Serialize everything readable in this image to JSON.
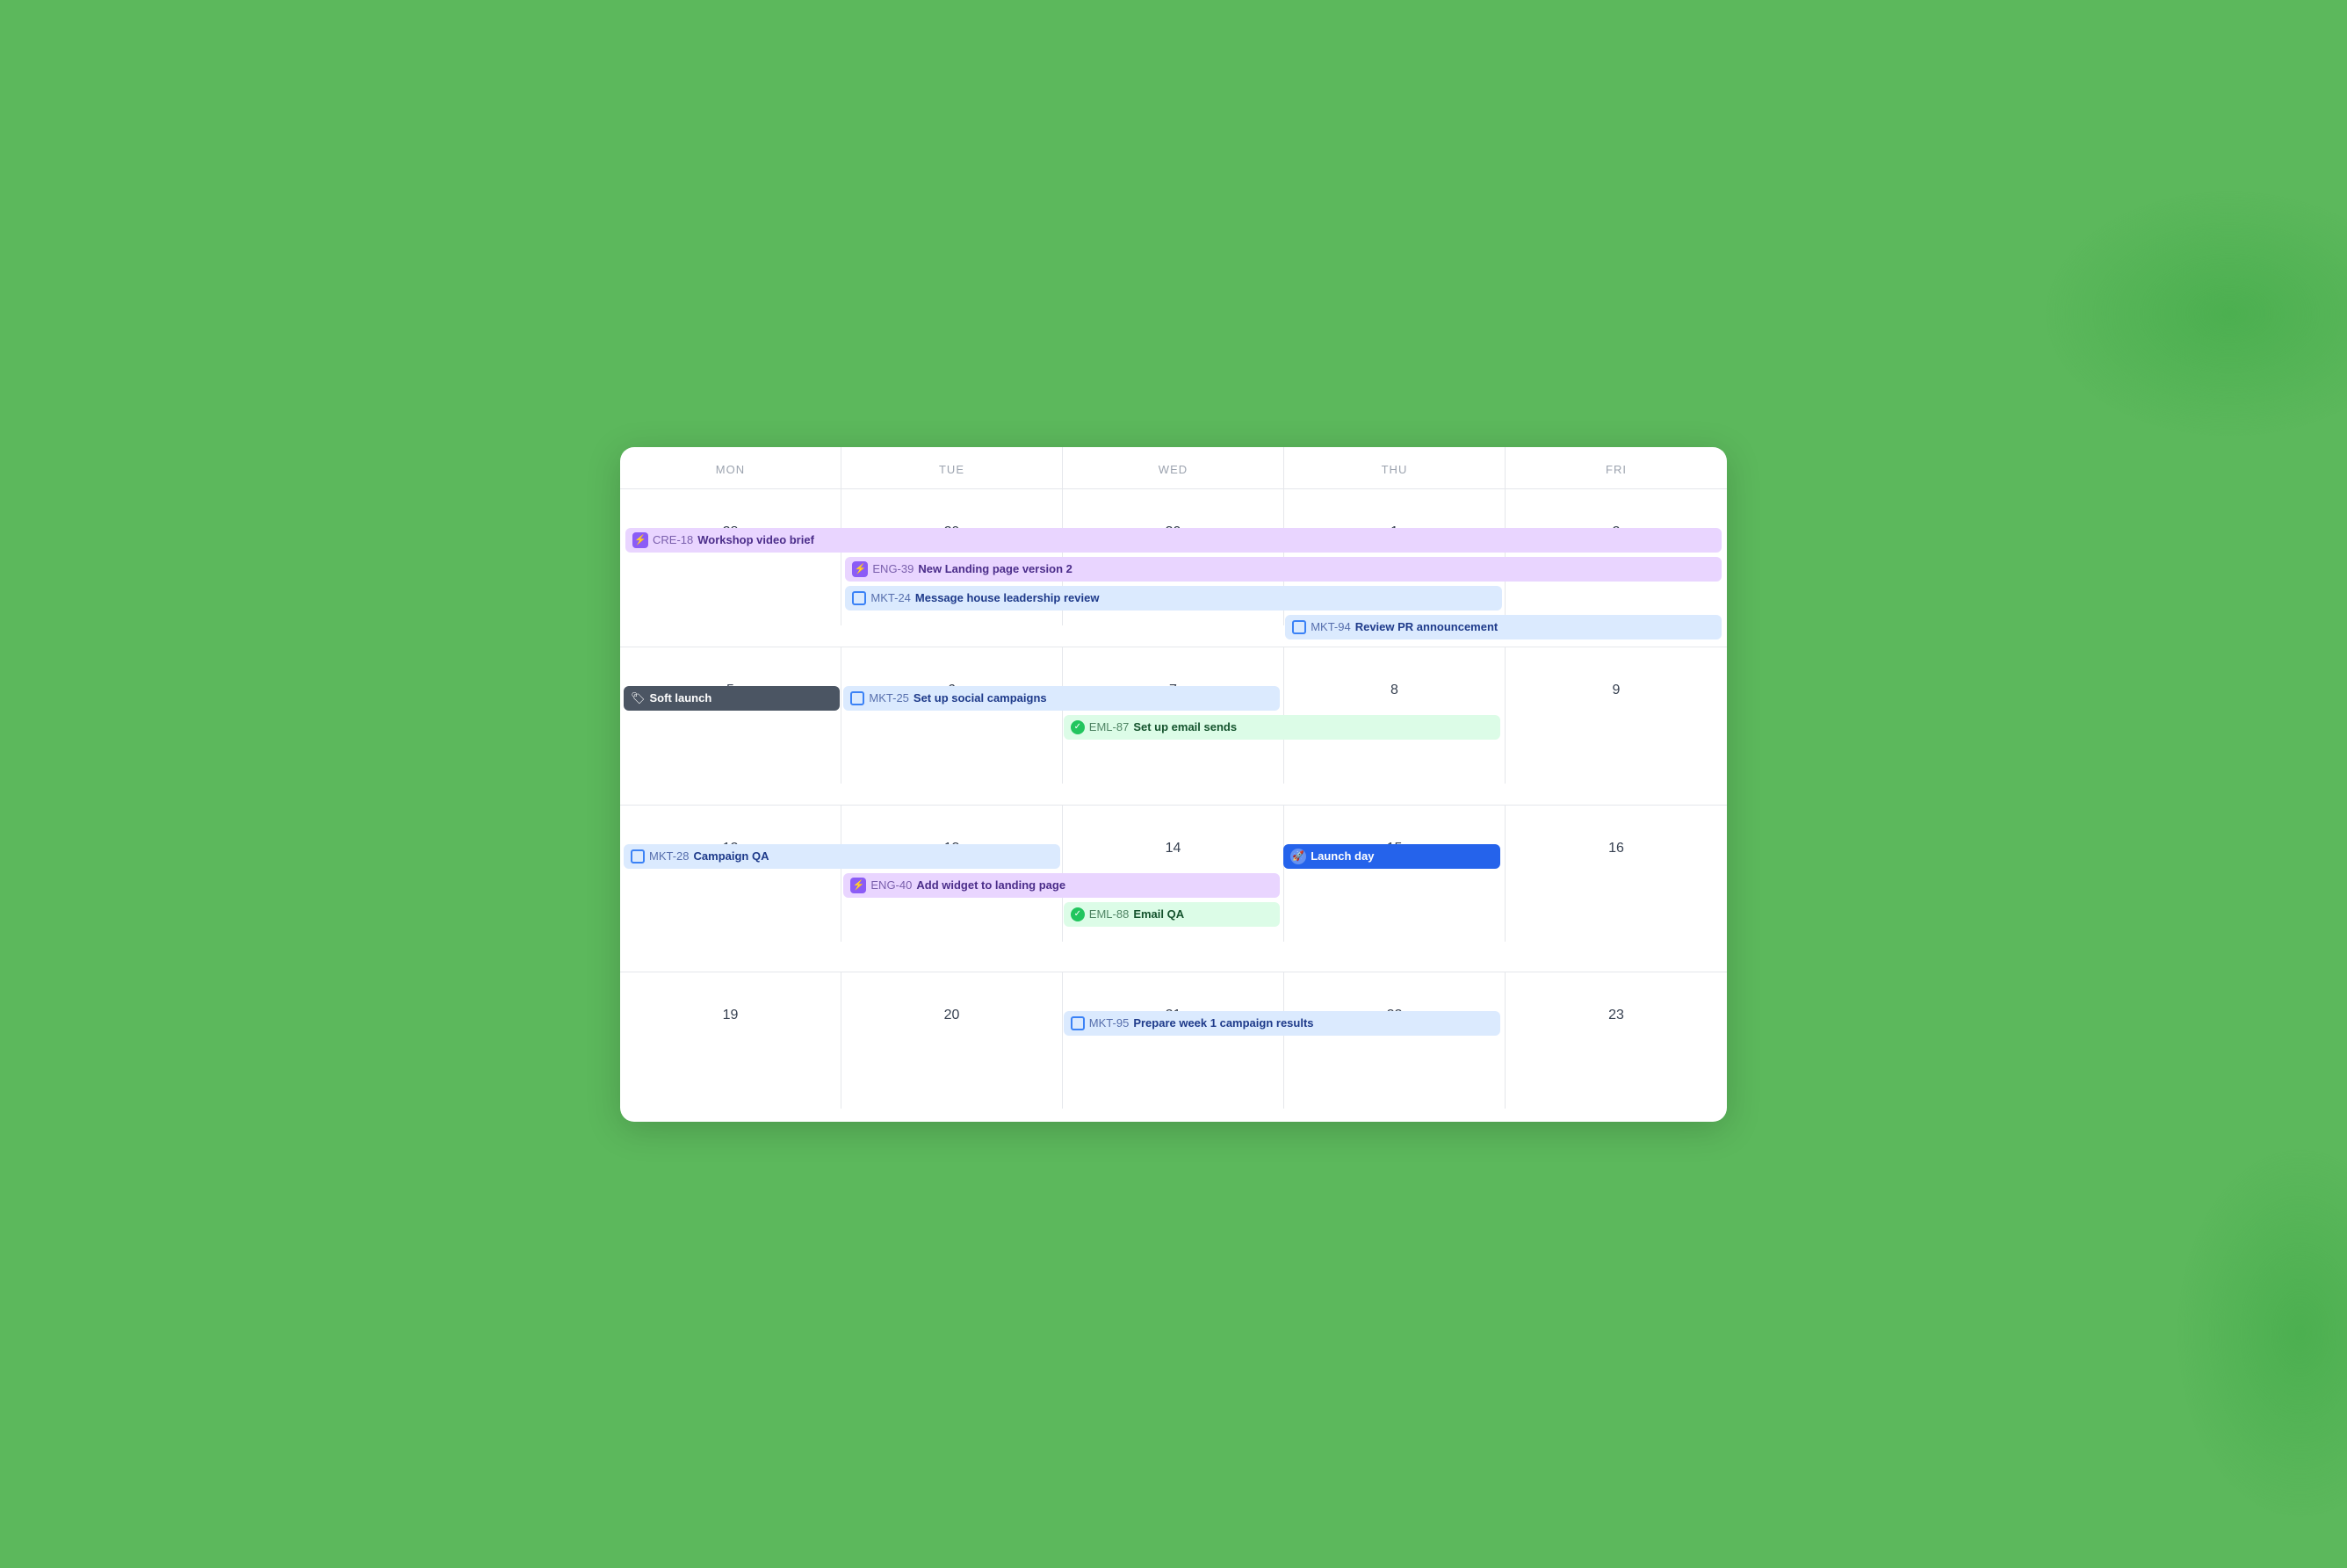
{
  "calendar": {
    "headers": [
      "MON",
      "TUE",
      "WED",
      "THU",
      "FRI"
    ],
    "weeks": [
      {
        "dates": [
          "28",
          "29",
          "30",
          "1",
          "2"
        ],
        "events": [
          {
            "id": "cre18-workshop",
            "label": "CRE-18",
            "name": "Workshop video brief",
            "color": "purple",
            "icon": "bolt",
            "col_start": 1,
            "col_end": 5,
            "row": 1
          },
          {
            "id": "eng39-landing",
            "label": "ENG-39",
            "name": "New Landing page version 2",
            "color": "purple",
            "icon": "bolt",
            "col_start": 2,
            "col_end": 5,
            "row": 2
          },
          {
            "id": "mkt24-message",
            "label": "MKT-24",
            "name": "Message house leadership review",
            "color": "blue",
            "icon": "square",
            "col_start": 2,
            "col_end": 4,
            "row": 3
          },
          {
            "id": "mkt94-review",
            "label": "MKT-94",
            "name": "Review PR announcement",
            "color": "blue",
            "icon": "square",
            "col_start": 4,
            "col_end": 5,
            "row": 4
          }
        ]
      },
      {
        "dates": [
          "5",
          "6",
          "7",
          "8",
          "9"
        ],
        "events": [
          {
            "id": "soft-launch",
            "label": "",
            "name": "Soft launch",
            "color": "dark",
            "icon": "launch",
            "col_start": 1,
            "col_end": 1,
            "row": 1
          },
          {
            "id": "mkt25-social",
            "label": "MKT-25",
            "name": "Set up social campaigns",
            "color": "blue",
            "icon": "square",
            "col_start": 2,
            "col_end": 3,
            "row": 1
          },
          {
            "id": "eml87-email",
            "label": "EML-87",
            "name": "Set up email sends",
            "color": "green",
            "icon": "shield",
            "col_start": 3,
            "col_end": 4,
            "row": 2
          }
        ]
      },
      {
        "dates": [
          "12",
          "13",
          "14",
          "15",
          "16"
        ],
        "events": [
          {
            "id": "mkt28-qa",
            "label": "MKT-28",
            "name": "Campaign QA",
            "color": "blue",
            "icon": "square",
            "col_start": 1,
            "col_end": 2,
            "row": 1
          },
          {
            "id": "launch-day",
            "label": "",
            "name": "Launch day",
            "color": "royal-blue",
            "icon": "rocket",
            "col_start": 4,
            "col_end": 4,
            "row": 1
          },
          {
            "id": "eng40-widget",
            "label": "ENG-40",
            "name": "Add widget to landing page",
            "color": "purple",
            "icon": "bolt",
            "col_start": 2,
            "col_end": 3,
            "row": 2
          },
          {
            "id": "eml88-qa",
            "label": "EML-88",
            "name": "Email QA",
            "color": "green",
            "icon": "shield",
            "col_start": 3,
            "col_end": 3,
            "row": 3
          }
        ]
      },
      {
        "dates": [
          "19",
          "20",
          "21",
          "22",
          "23"
        ],
        "events": [
          {
            "id": "mkt95-results",
            "label": "MKT-95",
            "name": "Prepare week 1 campaign results",
            "color": "blue",
            "icon": "square",
            "col_start": 3,
            "col_end": 4,
            "row": 1
          }
        ]
      }
    ]
  }
}
